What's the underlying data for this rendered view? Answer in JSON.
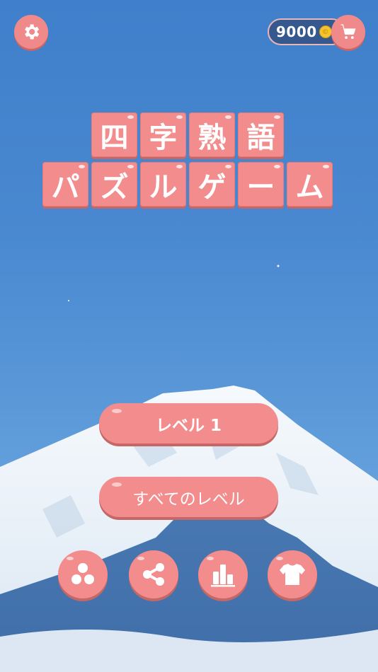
{
  "header": {
    "coins": "9000",
    "coin_symbol": "©",
    "icons": [
      "gear-icon",
      "cart-icon"
    ]
  },
  "title": {
    "row1": [
      "四",
      "字",
      "熟",
      "語"
    ],
    "row2": [
      "パ",
      "ズ",
      "ル",
      "ゲ",
      "ー",
      "ム"
    ]
  },
  "buttons": {
    "level": "レベル 1",
    "all_levels": "すべてのレベル"
  },
  "toolbar": {
    "icons": [
      "more-apps-icon",
      "share-icon",
      "leaderboard-icon",
      "shirt-icon"
    ]
  },
  "colors": {
    "accent": "#f38c8c",
    "accent_shadow": "#c66767",
    "sky": "#4a89d0",
    "coin_bar": "#35588f"
  }
}
